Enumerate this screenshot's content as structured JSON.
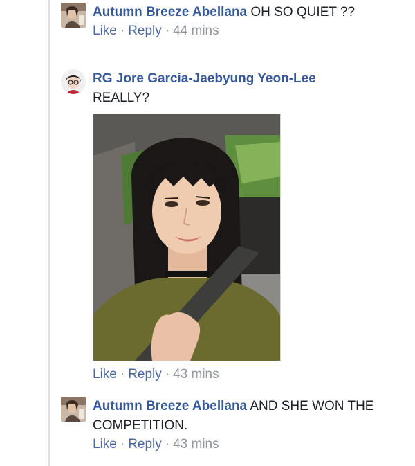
{
  "comments": [
    {
      "author": "Autumn Breeze Abellana",
      "text": "OH SO QUIET ??",
      "like": "Like",
      "reply": "Reply",
      "time": "44 mins"
    },
    {
      "author": "RG Jore Garcia-Jaebyung Yeon-Lee",
      "text": "REALLY?",
      "like": "Like",
      "reply": "Reply",
      "time": "43 mins"
    },
    {
      "author": "Autumn Breeze Abellana",
      "text": "AND SHE WON THE COMPETITION.",
      "like": "Like",
      "reply": "Reply",
      "time": "43 mins"
    }
  ],
  "separator": "·",
  "colors": {
    "author_link": "#365899",
    "action_link": "#4b67a1",
    "muted": "#90949c",
    "rule": "#dddfe2"
  }
}
